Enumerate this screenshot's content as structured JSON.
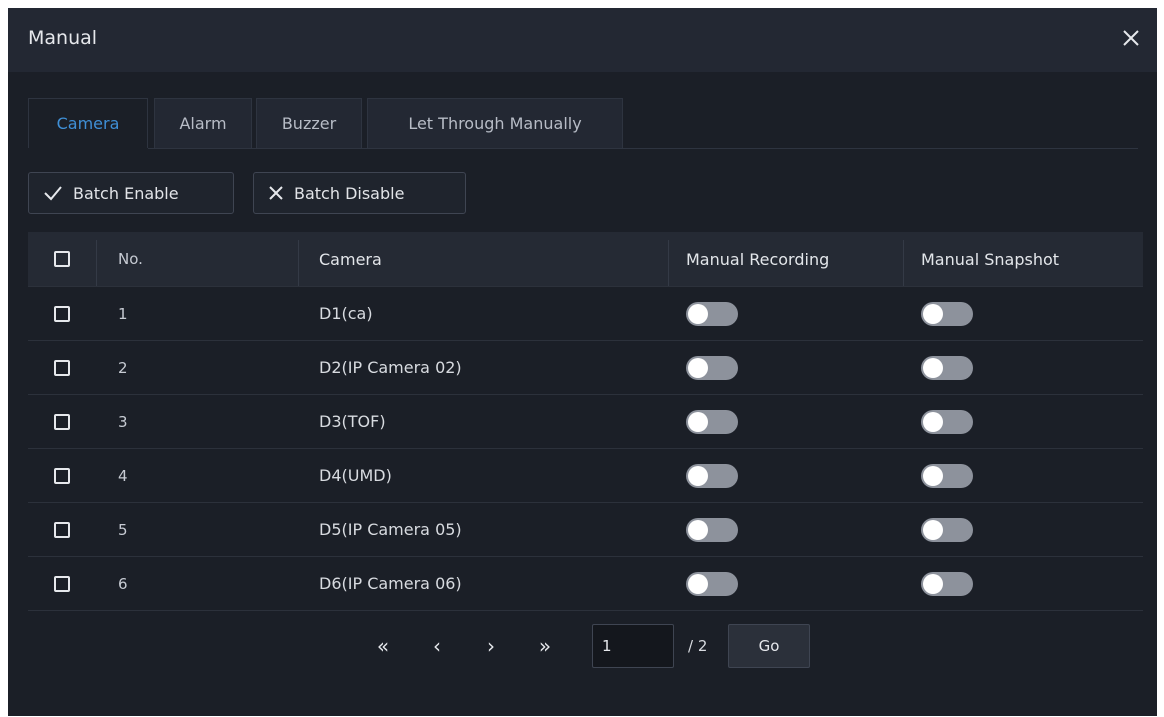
{
  "dialog": {
    "title": "Manual",
    "close_icon": "close-icon"
  },
  "tabs": [
    {
      "label": "Camera",
      "active": true
    },
    {
      "label": "Alarm",
      "active": false
    },
    {
      "label": "Buzzer",
      "active": false
    },
    {
      "label": "Let Through Manually",
      "active": false
    }
  ],
  "toolbar": {
    "batch_enable_label": "Batch Enable",
    "batch_enable_icon": "check-icon",
    "batch_disable_label": "Batch Disable",
    "batch_disable_icon": "x-icon"
  },
  "table": {
    "headers": {
      "no": "No.",
      "camera": "Camera",
      "manual_recording": "Manual Recording",
      "manual_snapshot": "Manual Snapshot"
    },
    "rows": [
      {
        "no": "1",
        "camera": "D1(ca)",
        "manual_recording": false,
        "manual_snapshot": false
      },
      {
        "no": "2",
        "camera": "D2(IP Camera 02)",
        "manual_recording": false,
        "manual_snapshot": false
      },
      {
        "no": "3",
        "camera": "D3(TOF)",
        "manual_recording": false,
        "manual_snapshot": false
      },
      {
        "no": "4",
        "camera": "D4(UMD)",
        "manual_recording": false,
        "manual_snapshot": false
      },
      {
        "no": "5",
        "camera": "D5(IP Camera 05)",
        "manual_recording": false,
        "manual_snapshot": false
      },
      {
        "no": "6",
        "camera": "D6(IP Camera 06)",
        "manual_recording": false,
        "manual_snapshot": false
      }
    ]
  },
  "pagination": {
    "first_glyph": "«",
    "prev_glyph": "‹",
    "next_glyph": "›",
    "last_glyph": "»",
    "current_page": "1",
    "total_label": "/ 2",
    "go_label": "Go"
  },
  "colors": {
    "accent": "#3f8fd6",
    "background": "#1b1f27",
    "toggle_off": "#8d929c"
  }
}
